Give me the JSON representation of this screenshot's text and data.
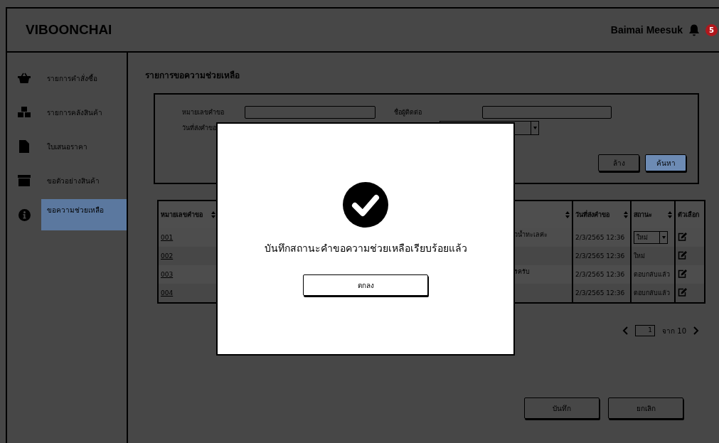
{
  "header": {
    "brand": "VIBOONCHAI",
    "user": "Baimai Meesuk",
    "notification_count": "5"
  },
  "sidebar": {
    "items": [
      {
        "label": "รายการคำสั่งซื้อ",
        "selected": false
      },
      {
        "label": "รายการคลังสินค้า",
        "selected": false
      },
      {
        "label": "ใบเสนอราคา",
        "selected": false
      },
      {
        "label": "ขอตัวอย่างสินค้า",
        "selected": false
      },
      {
        "label": "ขอความช่วยเหลือ",
        "selected": true
      }
    ]
  },
  "page_title": "รายการขอความช่วยเหลือ",
  "filter": {
    "fields": [
      {
        "label": "หมายเลขคำขอ"
      },
      {
        "label": "ชื่อผู้ติดต่อ"
      },
      {
        "label": "วันที่ส่งคำขอ"
      }
    ],
    "buttons": [
      {
        "label": "ล้าง",
        "primary": false
      },
      {
        "label": "ค้นหา",
        "primary": true
      }
    ]
  },
  "table": {
    "columns": [
      {
        "label": "หมายเลขคำขอ",
        "sortable": true
      },
      {
        "sortable": true
      },
      {
        "label": "วันที่ส่งคำขอ",
        "sortable": true
      },
      {
        "label": "สถานะ",
        "sortable": true
      },
      {
        "label": "ตัวเลือก",
        "sortable": false
      }
    ],
    "rows": [
      {
        "id": "001",
        "column_2": "วน้ำทะเลค่ะ",
        "date": "2/3/2565 12:36",
        "status": {
          "kind": "select",
          "value": "ใหม่"
        }
      },
      {
        "id": "002",
        "date": "2/3/2565 12:36",
        "status": {
          "kind": "text",
          "value": "ใหม่"
        }
      },
      {
        "id": "003",
        "column_2": "รครับ",
        "date": "2/3/2565 12:36",
        "status": {
          "kind": "text",
          "value": "ตอบกลับแล้ว"
        }
      },
      {
        "id": "004",
        "date": "2/3/2565 12:36",
        "status": {
          "kind": "text",
          "value": "ตอบกลับแล้ว"
        }
      }
    ]
  },
  "pagination": {
    "page": "1",
    "of_label": "จาก 10"
  },
  "actions": [
    {
      "label": "บันทึก"
    },
    {
      "label": "ยกเลิก"
    }
  ],
  "dialog": {
    "message": "บันทึกสถานะคำขอความช่วยเหลือเรียบร้อยแล้ว",
    "button": "ตกลง"
  }
}
